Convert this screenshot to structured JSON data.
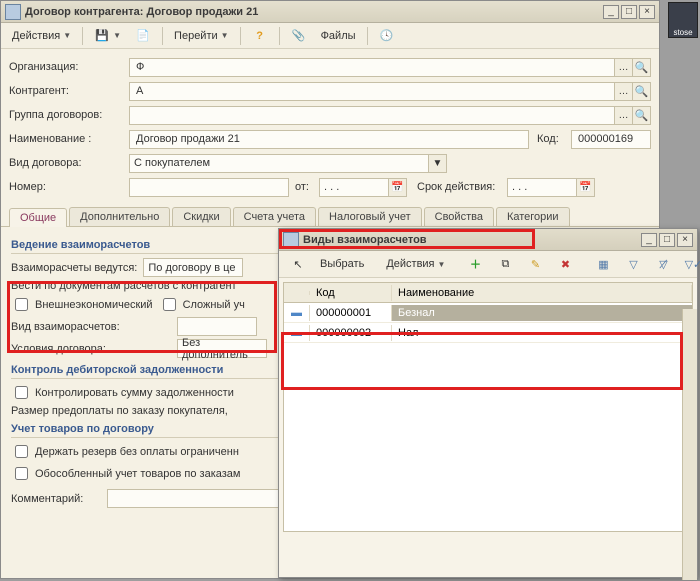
{
  "main_window": {
    "title": "Договор контрагента: Договор продажи 21",
    "toolbar": {
      "actions": "Действия",
      "go": "Перейти",
      "files": "Файлы"
    },
    "labels": {
      "organization": "Организация:",
      "contractor": "Контрагент:",
      "contract_group": "Группа договоров:",
      "name": "Наименование :",
      "code": "Код:",
      "contract_type": "Вид договора:",
      "number": "Номер:",
      "from": "от:",
      "validity": "Срок действия:",
      "settlement_type": "Вид взаиморасчетов:",
      "conditions": "Условия договора:",
      "prepay_size": "Размер предоплаты по заказу покупателя, ",
      "comment": "Комментарий:"
    },
    "values": {
      "organization": "Ф",
      "contractor": "А",
      "contract_group": "",
      "name": "Договор продажи 21",
      "code": "000000169",
      "contract_type": "С покупателем",
      "number": "",
      "date_from": ". . .",
      "validity": ". . .",
      "settlement_type": "",
      "conditions": "Без дополнитель",
      "comment": ""
    },
    "tabs": [
      "Общие",
      "Дополнительно",
      "Скидки",
      "Счета учета",
      "Налоговый учет",
      "Свойства",
      "Категории"
    ],
    "section_settlements": "Ведение взаиморасчетов",
    "settle_mode_label": "Взаиморасчеты ведутся:",
    "settle_mode_value": "По договору в це",
    "settle_docs": "Вести по документам расчетов с контрагент",
    "chk_foreign": "Внешнеэкономический",
    "chk_complex": "Сложный уч",
    "section_debt": "Контроль дебиторской задолженности",
    "chk_control_debt": "Контролировать сумму задолженности",
    "section_goods": "Учет товаров по договору",
    "chk_reserve": "Держать резерв без оплаты ограниченн",
    "chk_separate": "Обособленный учет товаров по заказам"
  },
  "child_window": {
    "title": "Виды взаиморасчетов",
    "toolbar": {
      "select": "Выбрать",
      "actions": "Действия"
    },
    "columns": {
      "code": "Код",
      "name": "Наименование"
    },
    "rows": [
      {
        "code": "000000001",
        "name": "Безнал"
      },
      {
        "code": "000000002",
        "name": "Нал"
      }
    ]
  },
  "logo": "stose"
}
